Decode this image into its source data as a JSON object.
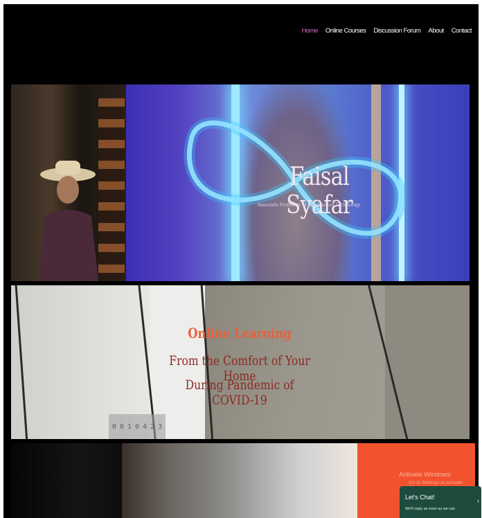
{
  "nav": {
    "items": [
      {
        "label": "Home",
        "active": true
      },
      {
        "label": "Online Courses"
      },
      {
        "label": "Discussion Forum"
      },
      {
        "label": "About"
      },
      {
        "label": "Contact"
      }
    ]
  },
  "hero": {
    "title": "Faisal Syafar",
    "subtitle": "Associate Professor of Information Technology"
  },
  "learning": {
    "title": "Online Learning",
    "line1": "From the Comfort of Your Home",
    "line2": "During Pandemic of COVID-19"
  },
  "counter": {
    "digits": [
      "0",
      "0",
      "1",
      "0",
      "4",
      "2",
      "3"
    ]
  },
  "windows_notice": {
    "title": "Activate Windows",
    "subtitle": "Go to Settings to activate Windows."
  },
  "chat": {
    "title": "Let's Chat!",
    "subtitle": "We'll reply as soon as we can",
    "close_icon": "chevron-right-icon"
  },
  "colors": {
    "nav_active": "#d06acb",
    "learn_title": "#e8603d",
    "learn_text": "#8a2b25",
    "chat_bg": "#1d4b3d",
    "orange_block": "#f2532e"
  }
}
